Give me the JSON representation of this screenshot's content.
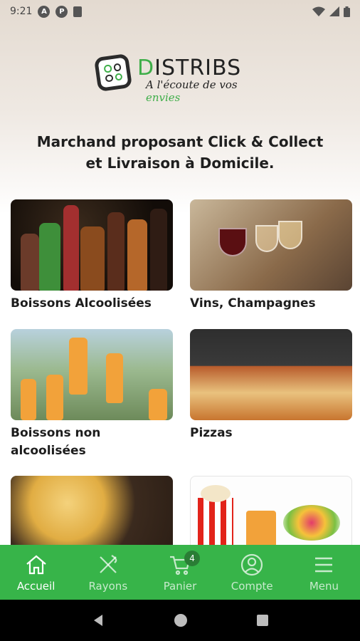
{
  "status_bar": {
    "time": "9:21",
    "icons": [
      "app-a-icon",
      "app-p-icon",
      "sd-card-icon",
      "wifi-icon",
      "signal-icon",
      "battery-icon"
    ]
  },
  "brand": {
    "name_first": "D",
    "name_rest": "ISTRIBS",
    "tagline_main": "A l'écoute de vos ",
    "tagline_accent": "envies",
    "accent_color": "#3fae49"
  },
  "headline": {
    "line1": "Marchand proposant Click & Collect",
    "line2": "et Livraison à Domicile."
  },
  "categories": [
    {
      "label": "Boissons Alcoolisées"
    },
    {
      "label": "Vins, Champagnes"
    },
    {
      "label": "Boissons non alcoolisées"
    },
    {
      "label": "Pizzas"
    },
    {
      "label": ""
    },
    {
      "label": ""
    }
  ],
  "bottom_nav": {
    "color": "#37b449",
    "items": [
      {
        "label": "Accueil",
        "icon": "home-icon",
        "active": true
      },
      {
        "label": "Rayons",
        "icon": "utensils-icon",
        "active": false
      },
      {
        "label": "Panier",
        "icon": "cart-icon",
        "active": false,
        "badge": "4"
      },
      {
        "label": "Compte",
        "icon": "account-icon",
        "active": false
      },
      {
        "label": "Menu",
        "icon": "menu-icon",
        "active": false
      }
    ]
  },
  "android_nav": [
    "back-icon",
    "home-circle-icon",
    "recents-icon"
  ]
}
